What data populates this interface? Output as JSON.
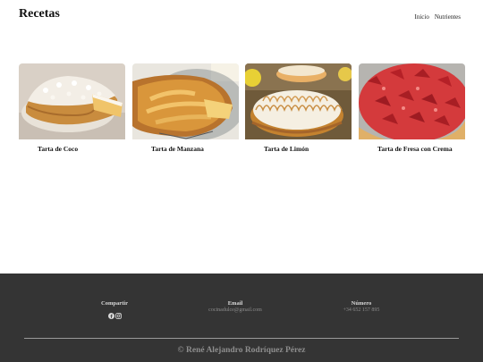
{
  "header": {
    "title": "Recetas",
    "nav": [
      "Inicio",
      "Nutrientes"
    ]
  },
  "cards": [
    {
      "title": "Tarta de Coco",
      "image": "coconut-tart-image"
    },
    {
      "title": "Tarta de Manzana",
      "image": "apple-tart-image"
    },
    {
      "title": "Tarta de Limón",
      "image": "lemon-meringue-tart-image"
    },
    {
      "title": "Tarta de Fresa con Crema",
      "image": "strawberry-cream-tart-image"
    }
  ],
  "footer": {
    "share_label": "Compartir",
    "social_icons": [
      "facebook-icon",
      "instagram-icon"
    ],
    "email_label": "Email",
    "email_value": "cocinadulce@gmail.com",
    "phone_label": "Número",
    "phone_value": "+34 652 157 895",
    "copyright": "© René Alejandro Rodríquez Pérez"
  },
  "colors": {
    "footer_bg": "#343434",
    "text": "#111111",
    "footer_muted": "#8e8e8e"
  }
}
